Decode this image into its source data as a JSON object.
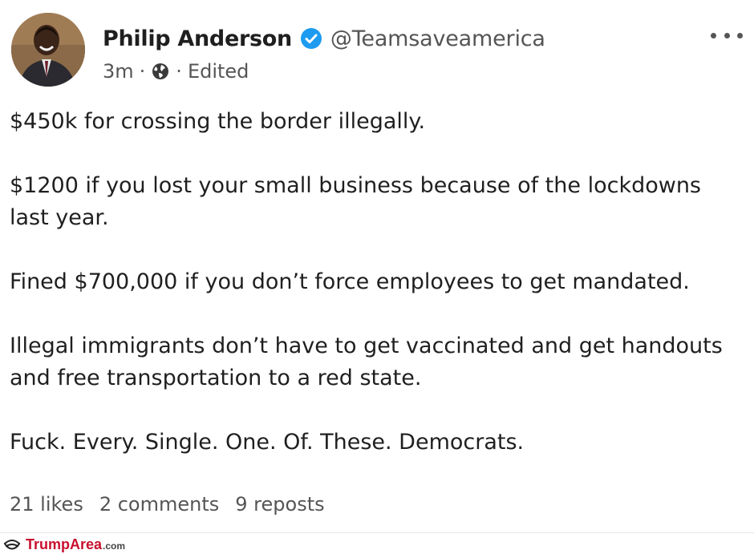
{
  "post": {
    "author_name": "Philip Anderson",
    "author_handle": "@Teamsaveamerica",
    "time_ago": "3m",
    "separator": "·",
    "edited_label": "Edited",
    "icons": {
      "verified": "verified-badge-icon",
      "visibility": "globe-icon",
      "more": "more-options-icon"
    },
    "colors": {
      "verified": "#1d9bf0",
      "text": "#1f1f1f",
      "secondary_text": "#555555"
    },
    "paragraphs": [
      "$450k for crossing the border illegally.",
      "$1200 if you lost your small business because of the lockdowns last year.",
      "Fined $700,000 if you don’t force employees to get mandated.",
      "Illegal immigrants don’t have to get vaccinated and get handouts and free transportation to a red state.",
      "Fuck. Every. Single. One. Of. These. Democrats."
    ],
    "stats": {
      "likes": "21 likes",
      "comments": "2 comments",
      "reposts": "9 reposts"
    }
  },
  "watermark": {
    "brand": "TrumpArea",
    "tld": ".com",
    "color": "#c8102e"
  }
}
